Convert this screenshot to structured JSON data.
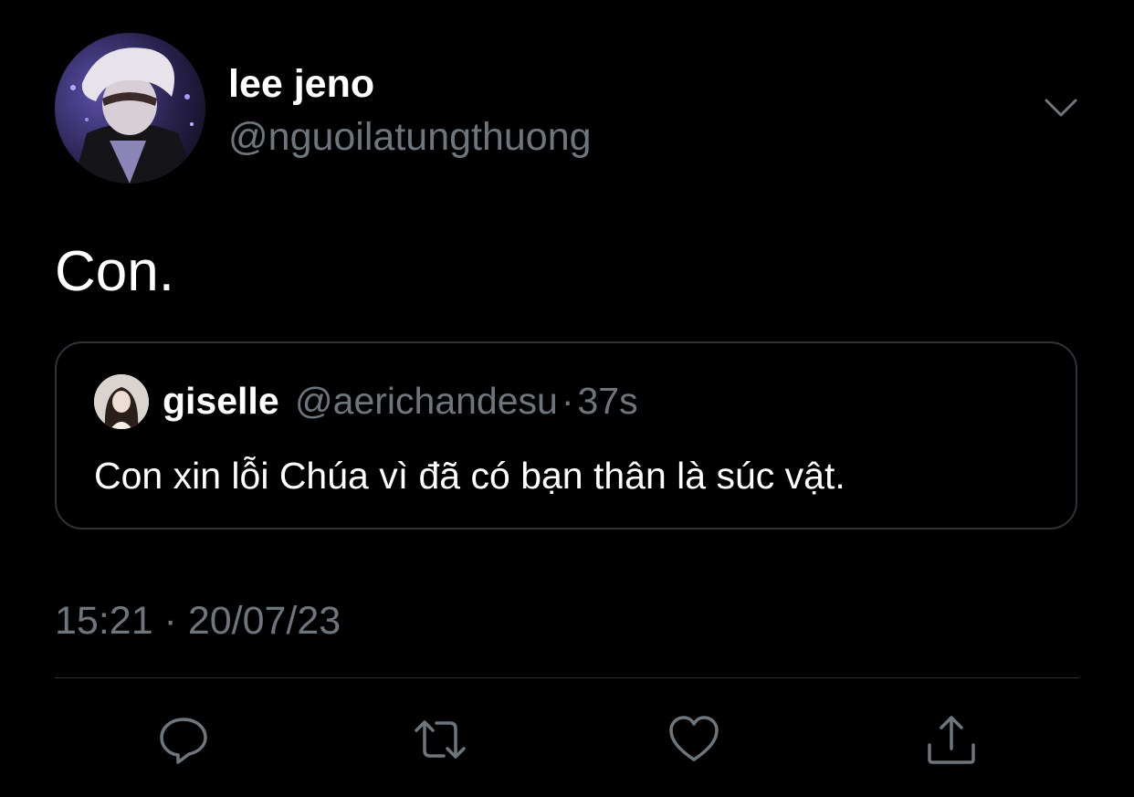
{
  "tweet": {
    "author": {
      "display_name": "lee jeno",
      "handle": "@nguoilatungthuong"
    },
    "text": "Con.",
    "timestamp": "15:21 · 20/07/23",
    "quoted": {
      "display_name": "giselle",
      "handle": "@aerichandesu",
      "separator": "·",
      "time": "37s",
      "text": "Con xin lỗi Chúa vì đã có bạn thân là súc vật."
    }
  },
  "actions": [
    {
      "name": "reply",
      "icon": "reply-icon"
    },
    {
      "name": "retweet",
      "icon": "retweet-icon"
    },
    {
      "name": "like",
      "icon": "heart-icon"
    },
    {
      "name": "share",
      "icon": "share-icon"
    }
  ],
  "colors": {
    "background": "#000000",
    "primary_text": "#ffffff",
    "secondary_text": "#6e767d",
    "border": "#2f3336"
  }
}
